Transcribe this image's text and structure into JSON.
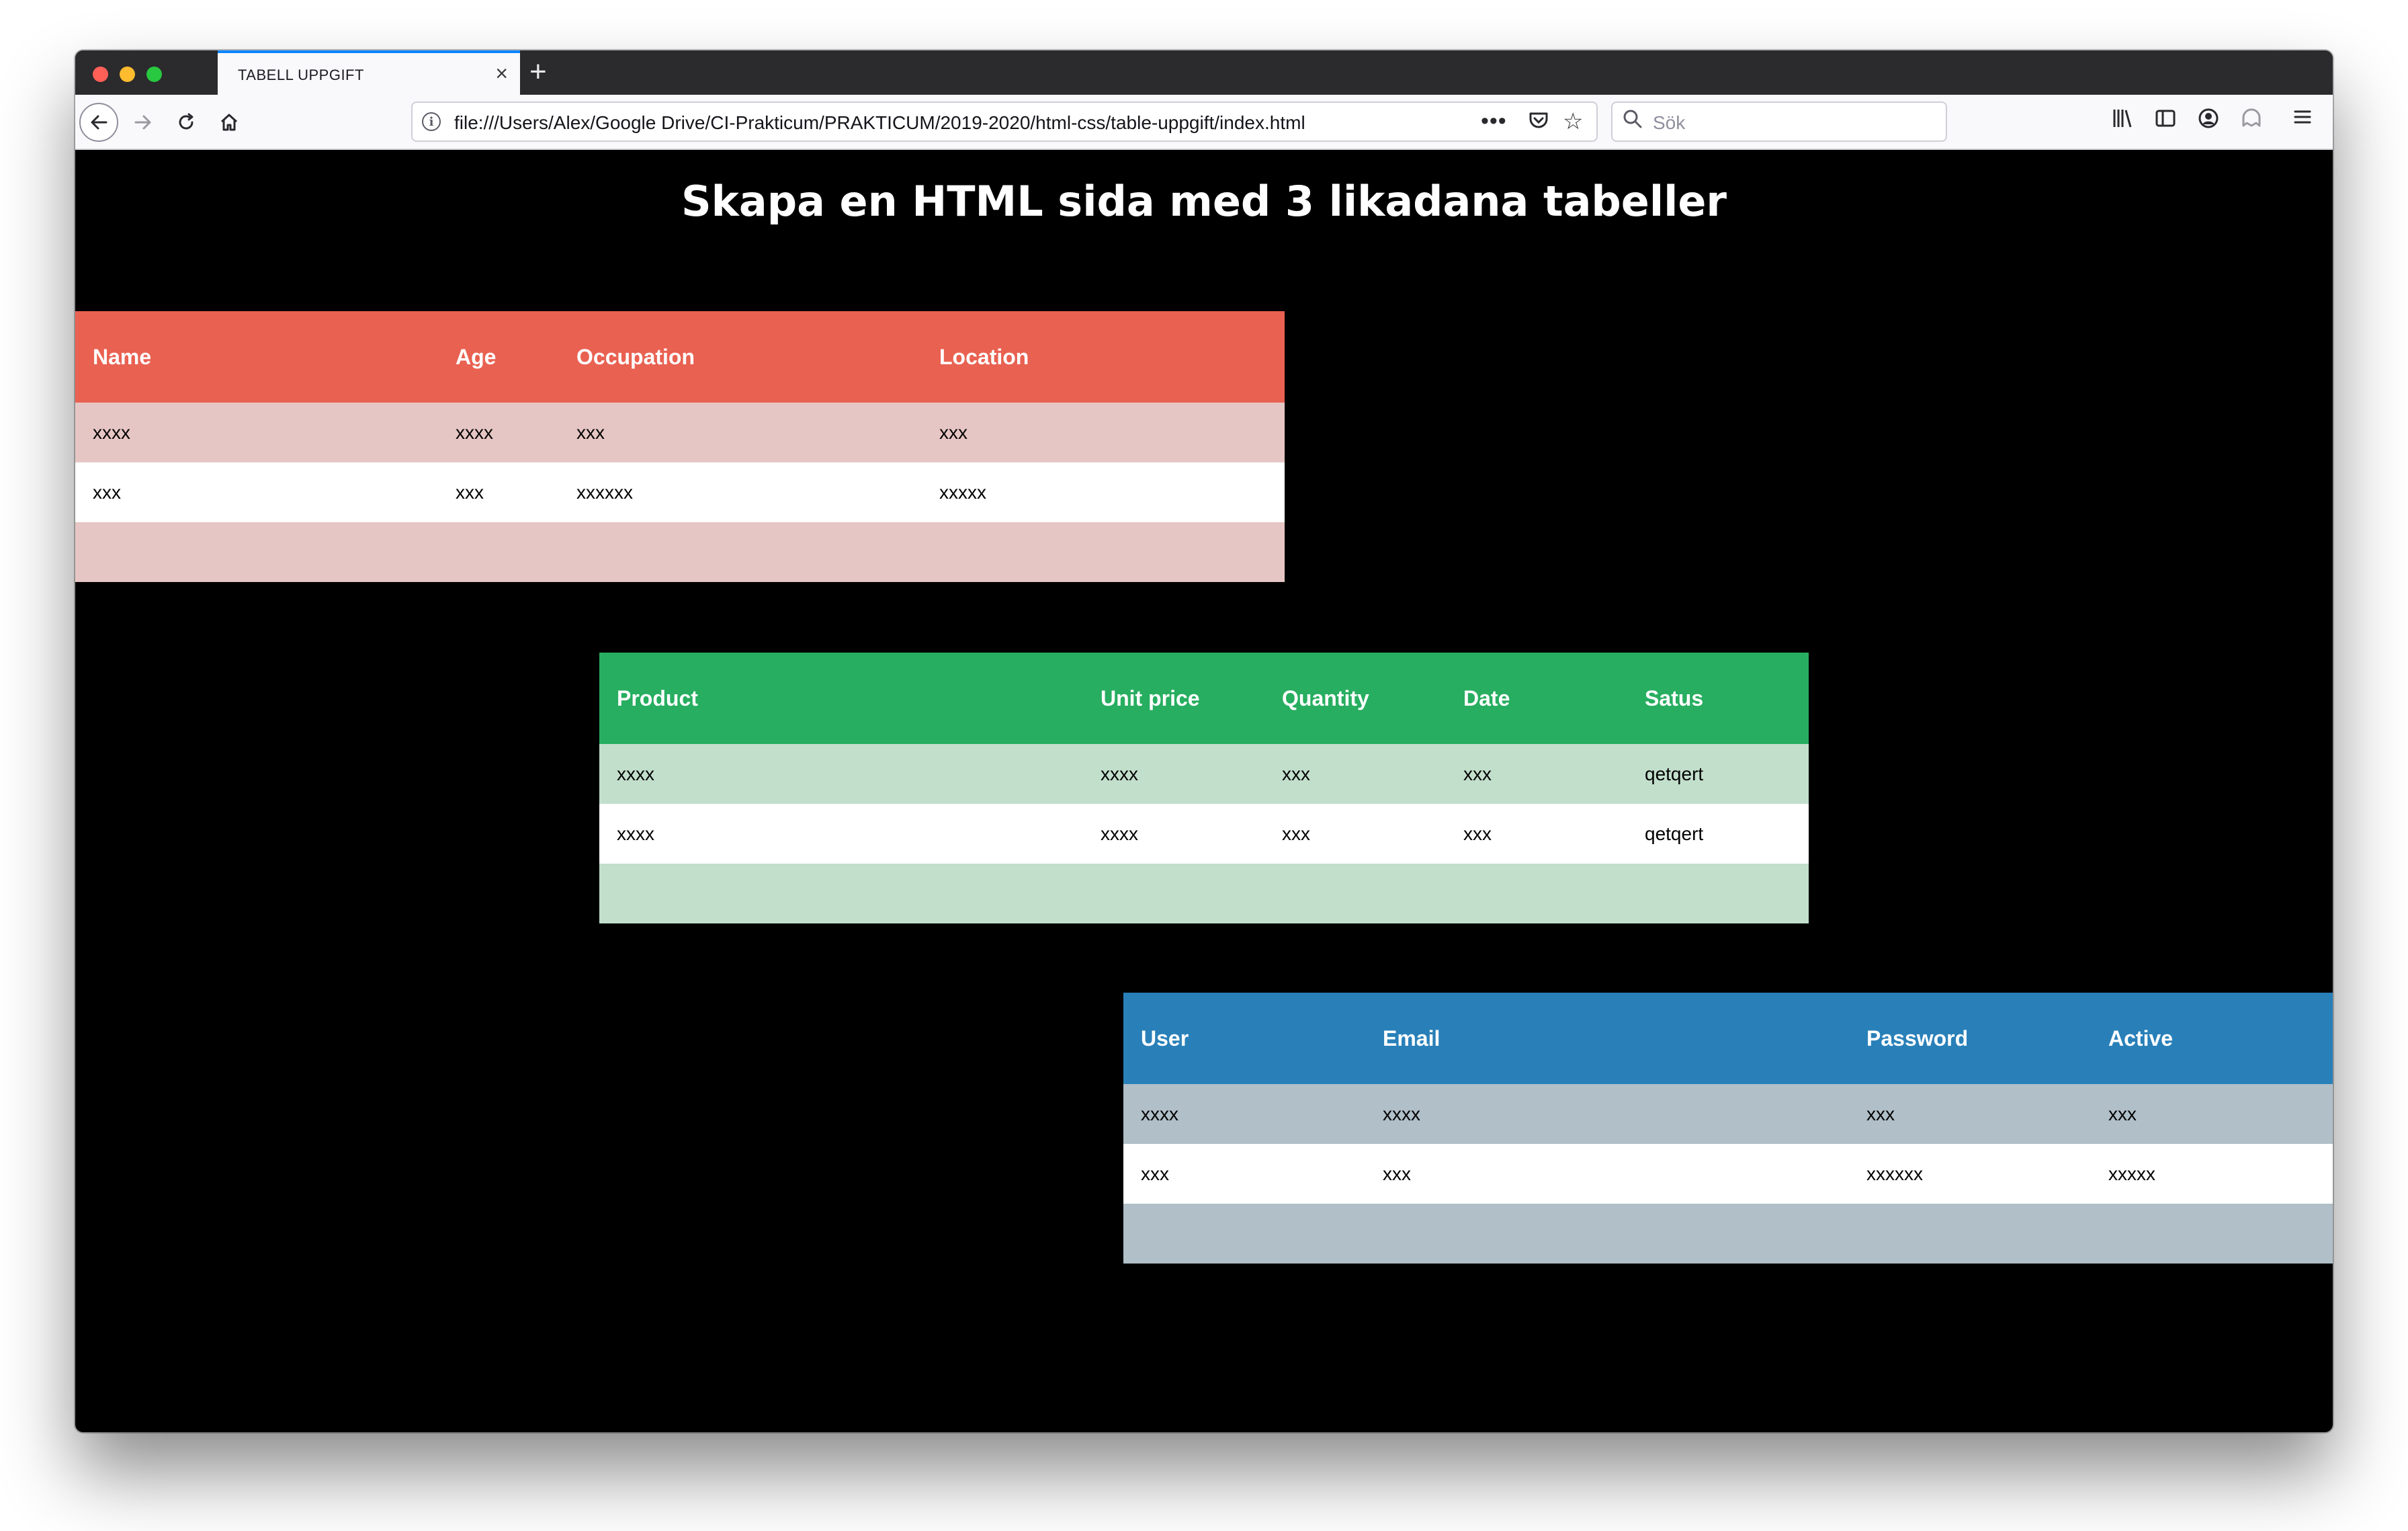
{
  "browser": {
    "tab_title": "TABELL UPPGIFT",
    "tab_close": "×",
    "new_tab": "+",
    "url": "file:///Users/Alex/Google Drive/CI-Prakticum/PRAKTICUM/2019-2020/html-css/table-uppgift/index.html",
    "search_placeholder": "Sök",
    "icons": [
      "back-icon",
      "forward-icon",
      "reload-icon",
      "home-icon",
      "info-icon",
      "more-icon",
      "pocket-icon",
      "bookmark-star-icon",
      "search-icon",
      "library-icon",
      "sidebar-icon",
      "account-icon",
      "ghost-icon",
      "menu-icon"
    ]
  },
  "page": {
    "title": "Skapa en HTML sida med 3 likadana tabeller"
  },
  "tables": [
    {
      "color_header": "#e96151",
      "color_stripe": "#e6c6c4",
      "headers": [
        "Name",
        "Age",
        "Occupation",
        "Location"
      ],
      "rows": [
        [
          "xxxx",
          "xxxx",
          "xxx",
          "xxx"
        ],
        [
          "xxx",
          "xxx",
          "xxxxxx",
          "xxxxx"
        ],
        [
          "",
          "",
          "",
          ""
        ]
      ]
    },
    {
      "color_header": "#27ae60",
      "color_stripe": "#c2dfcc",
      "headers": [
        "Product",
        "Unit price",
        "Quantity",
        "Date",
        "Satus"
      ],
      "rows": [
        [
          "xxxx",
          "xxxx",
          "xxx",
          "xxx",
          "qetqert"
        ],
        [
          "xxxx",
          "xxxx",
          "xxx",
          "xxx",
          "qetqert"
        ],
        [
          "",
          "",
          "",
          "",
          ""
        ]
      ]
    },
    {
      "color_header": "#2980b9",
      "color_stripe": "#b0bfc8",
      "headers": [
        "User",
        "Email",
        "Password",
        "Active"
      ],
      "rows": [
        [
          "xxxx",
          "xxxx",
          "xxx",
          "xxx"
        ],
        [
          "xxx",
          "xxx",
          "xxxxxx",
          "xxxxx"
        ],
        [
          "",
          "",
          "",
          ""
        ]
      ]
    }
  ]
}
